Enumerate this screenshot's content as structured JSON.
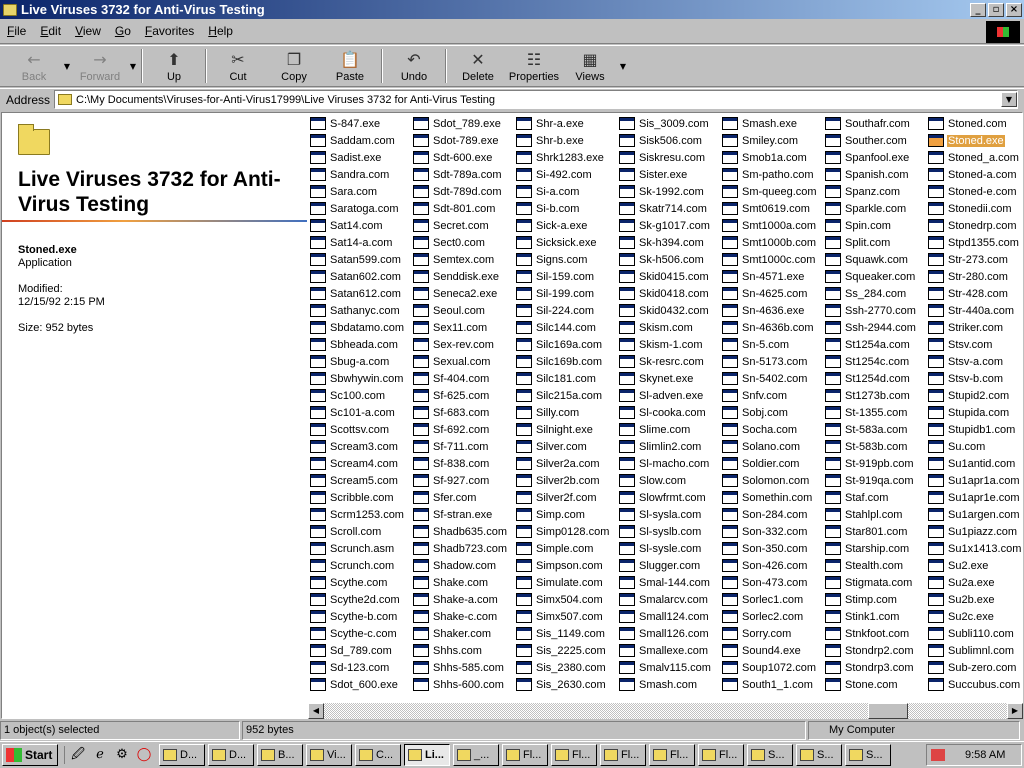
{
  "window": {
    "title": "Live Viruses 3732 for Anti-Virus Testing",
    "controls": [
      "_",
      "▫",
      "×"
    ]
  },
  "menu": [
    "File",
    "Edit",
    "View",
    "Go",
    "Favorites",
    "Help"
  ],
  "toolbar": [
    {
      "label": "Back",
      "icon": "←",
      "enabled": false
    },
    {
      "label": "Forward",
      "icon": "→",
      "enabled": false
    },
    {
      "label": "Up",
      "icon": "⬆",
      "enabled": true
    },
    {
      "label": "Cut",
      "icon": "✂",
      "enabled": true
    },
    {
      "label": "Copy",
      "icon": "❐",
      "enabled": true
    },
    {
      "label": "Paste",
      "icon": "📋",
      "enabled": true
    },
    {
      "label": "Undo",
      "icon": "↶",
      "enabled": true
    },
    {
      "label": "Delete",
      "icon": "✕",
      "enabled": true
    },
    {
      "label": "Properties",
      "icon": "☷",
      "enabled": true
    },
    {
      "label": "Views",
      "icon": "▦",
      "enabled": true
    }
  ],
  "address": {
    "label": "Address",
    "path": "C:\\My Documents\\Viruses-for-Anti-Virus17999\\Live Viruses 3732 for Anti-Virus Testing"
  },
  "left_pane": {
    "folder_title": "Live Viruses 3732 for Anti-Virus Testing",
    "selected_name": "Stoned.exe",
    "selected_type": "Application",
    "modified_label": "Modified:",
    "modified_value": "12/15/92 2:15 PM",
    "size": "Size: 952 bytes"
  },
  "files": [
    [
      "S-847.exe",
      "Saddam.com",
      "Sadist.exe",
      "Sandra.com",
      "Sara.com",
      "Saratoga.com",
      "Sat14.com",
      "Sat14-a.com",
      "Satan599.com",
      "Satan602.com",
      "Satan612.com",
      "Sathanyc.com",
      "Sbdatamo.com",
      "Sbheada.com",
      "Sbug-a.com",
      "Sbwhywin.com",
      "Sc100.com",
      "Sc101-a.com",
      "Scottsv.com",
      "Scream3.com",
      "Scream4.com",
      "Scream5.com",
      "Scribble.com",
      "Scrm1253.com",
      "Scroll.com",
      "Scrunch.asm",
      "Scrunch.com",
      "Scythe.com",
      "Scythe2d.com",
      "Scythe-b.com",
      "Scythe-c.com",
      "Sd_789.com",
      "Sd-123.com",
      "Sdot_600.exe"
    ],
    [
      "Sdot_789.exe",
      "Sdot-789.exe",
      "Sdt-600.exe",
      "Sdt-789a.com",
      "Sdt-789d.com",
      "Sdt-801.com",
      "Secret.com",
      "Sect0.com",
      "Semtex.com",
      "Senddisk.exe",
      "Seneca2.exe",
      "Seoul.com",
      "Sex11.com",
      "Sex-rev.com",
      "Sexual.com",
      "Sf-404.com",
      "Sf-625.com",
      "Sf-683.com",
      "Sf-692.com",
      "Sf-711.com",
      "Sf-838.com",
      "Sf-927.com",
      "Sfer.com",
      "Sf-stran.exe",
      "Shadb635.com",
      "Shadb723.com",
      "Shadow.com",
      "Shake.com",
      "Shake-a.com",
      "Shake-c.com",
      "Shaker.com",
      "Shhs.com",
      "Shhs-585.com",
      "Shhs-600.com"
    ],
    [
      "Shr-a.exe",
      "Shr-b.exe",
      "Shrk1283.exe",
      "Si-492.com",
      "Si-a.com",
      "Si-b.com",
      "Sick-a.exe",
      "Sicksick.exe",
      "Signs.com",
      "Sil-159.com",
      "Sil-199.com",
      "Sil-224.com",
      "Silc144.com",
      "Silc169a.com",
      "Silc169b.com",
      "Silc181.com",
      "Silc215a.com",
      "Silly.com",
      "Silnight.exe",
      "Silver.com",
      "Silver2a.com",
      "Silver2b.com",
      "Silver2f.com",
      "Simp.com",
      "Simp0128.com",
      "Simple.com",
      "Simpson.com",
      "Simulate.com",
      "Simx504.com",
      "Simx507.com",
      "Sis_1149.com",
      "Sis_2225.com",
      "Sis_2380.com",
      "Sis_2630.com"
    ],
    [
      "Sis_3009.com",
      "Sisk506.com",
      "Siskresu.com",
      "Sister.exe",
      "Sk-1992.com",
      "Skatr714.com",
      "Sk-g1017.com",
      "Sk-h394.com",
      "Sk-h506.com",
      "Skid0415.com",
      "Skid0418.com",
      "Skid0432.com",
      "Skism.com",
      "Skism-1.com",
      "Sk-resrc.com",
      "Skynet.exe",
      "Sl-adven.exe",
      "Sl-cooka.com",
      "Slime.com",
      "Slimlin2.com",
      "Sl-macho.com",
      "Slow.com",
      "Slowfrmt.com",
      "Sl-sysla.com",
      "Sl-syslb.com",
      "Sl-sysle.com",
      "Slugger.com",
      "Smal-144.com",
      "Smalarcv.com",
      "Small124.com",
      "Small126.com",
      "Smallexe.com",
      "Smalv115.com",
      "Smash.com"
    ],
    [
      "Smash.exe",
      "Smiley.com",
      "Smob1a.com",
      "Sm-patho.com",
      "Sm-queeg.com",
      "Smt0619.com",
      "Smt1000a.com",
      "Smt1000b.com",
      "Smt1000c.com",
      "Sn-4571.exe",
      "Sn-4625.com",
      "Sn-4636.exe",
      "Sn-4636b.com",
      "Sn-5.com",
      "Sn-5173.com",
      "Sn-5402.com",
      "Snfv.com",
      "Sobj.com",
      "Socha.com",
      "Solano.com",
      "Soldier.com",
      "Solomon.com",
      "Somethin.com",
      "Son-284.com",
      "Son-332.com",
      "Son-350.com",
      "Son-426.com",
      "Son-473.com",
      "Sorlec1.com",
      "Sorlec2.com",
      "Sorry.com",
      "Sound4.exe",
      "Soup1072.com",
      "South1_1.com"
    ],
    [
      "Southafr.com",
      "Souther.com",
      "Spanfool.exe",
      "Spanish.com",
      "Spanz.com",
      "Sparkle.com",
      "Spin.com",
      "Split.com",
      "Squawk.com",
      "Squeaker.com",
      "Ss_284.com",
      "Ssh-2770.com",
      "Ssh-2944.com",
      "St1254a.com",
      "St1254c.com",
      "St1254d.com",
      "St1273b.com",
      "St-1355.com",
      "St-583a.com",
      "St-583b.com",
      "St-919pb.com",
      "St-919qa.com",
      "Staf.com",
      "Stahlpl.com",
      "Star801.com",
      "Starship.com",
      "Stealth.com",
      "Stigmata.com",
      "Stimp.com",
      "Stink1.com",
      "Stnkfoot.com",
      "Stondrp2.com",
      "Stondrp3.com",
      "Stone.com"
    ],
    [
      "Stoned.com",
      "Stoned.exe",
      "Stoned_a.com",
      "Stoned-a.com",
      "Stoned-e.com",
      "Stonedii.com",
      "Stonedrp.com",
      "Stpd1355.com",
      "Str-273.com",
      "Str-280.com",
      "Str-428.com",
      "Str-440a.com",
      "Striker.com",
      "Stsv.com",
      "Stsv-a.com",
      "Stsv-b.com",
      "Stupid2.com",
      "Stupida.com",
      "Stupidb1.com",
      "Su.com",
      "Su1antid.com",
      "Su1apr1a.com",
      "Su1apr1e.com",
      "Su1argen.com",
      "Su1piazz.com",
      "Su1x1413.com",
      "Su2.exe",
      "Su2a.exe",
      "Su2b.exe",
      "Su2c.exe",
      "Subli110.com",
      "Sublimnl.com",
      "Sub-zero.com",
      "Succubus.com"
    ]
  ],
  "selected_file": "Stoned.exe",
  "status": {
    "objects": "1 object(s) selected",
    "size": "952 bytes",
    "zone": "My Computer"
  },
  "taskbar": {
    "start": "Start",
    "tasks": [
      "D...",
      "D...",
      "B...",
      "Vi...",
      "C...",
      "Li...",
      "_...",
      "Fl...",
      "Fl...",
      "Fl...",
      "Fl...",
      "Fl...",
      "S...",
      "S...",
      "S..."
    ],
    "active_task": 5,
    "clock": "9:58 AM"
  },
  "colors": {
    "title_start": "#0a246a",
    "title_end": "#a6caf0",
    "selection": "#e0a040"
  }
}
